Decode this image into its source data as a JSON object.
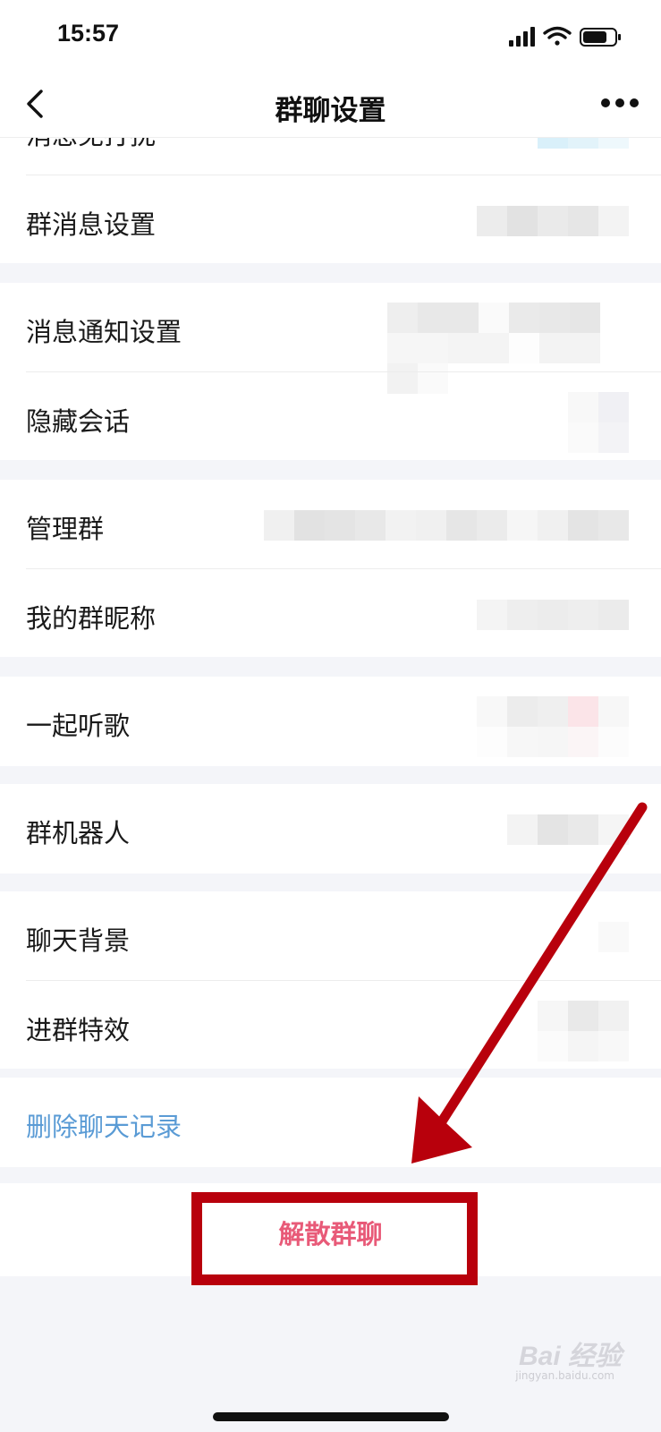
{
  "status": {
    "time": "15:57"
  },
  "nav": {
    "title": "群聊设置"
  },
  "rows": {
    "top_partial": "消息免打扰",
    "group_message_settings": "群消息设置",
    "notification_settings": "消息通知设置",
    "hide_conversation": "隐藏会话",
    "manage_group": "管理群",
    "my_group_nickname": "我的群昵称",
    "listen_together": "一起听歌",
    "group_bot": "群机器人",
    "chat_background": "聊天背景",
    "join_effect": "进群特效"
  },
  "actions": {
    "delete_history": "删除聊天记录",
    "dissolve_group": "解散群聊"
  },
  "watermark": {
    "brand": "Bai 经验",
    "url": "jingyan.baidu.com"
  },
  "colors": {
    "link_blue": "#5a9bd5",
    "danger_pink": "#e85a78",
    "annotation_red": "#b8000c",
    "background": "#f4f5f9"
  }
}
